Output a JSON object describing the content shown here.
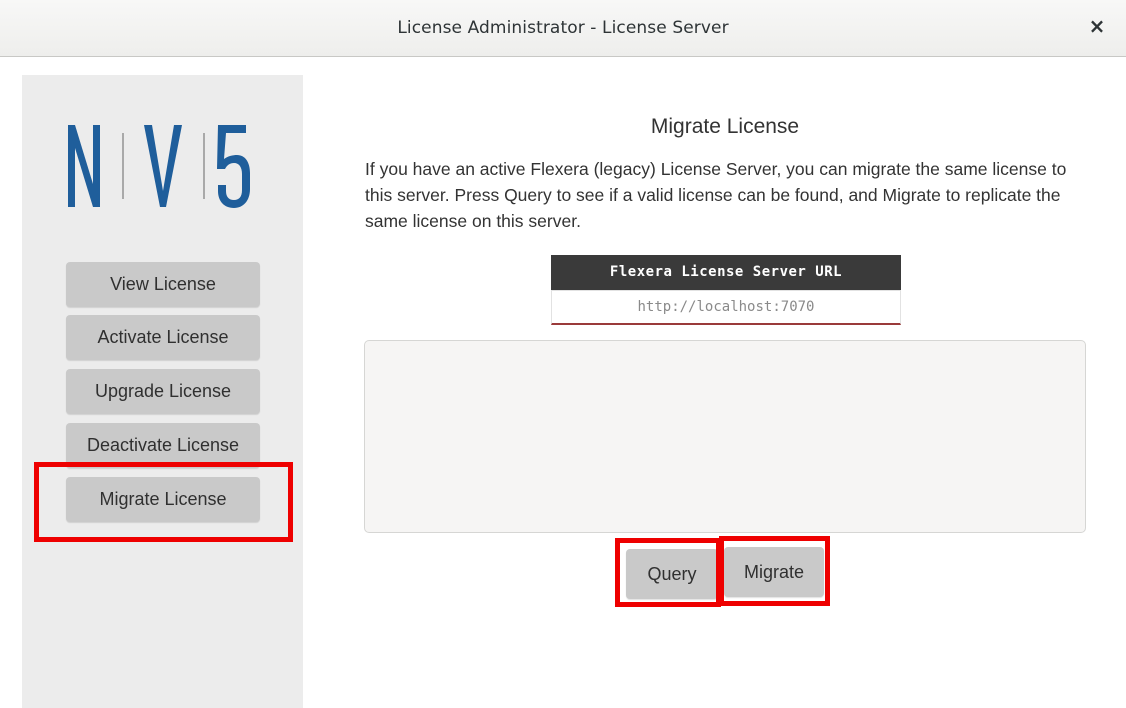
{
  "window": {
    "title": "License Administrator - License Server",
    "close_label": "×"
  },
  "logo": {
    "text": "NV5",
    "color": "#1f5e9b"
  },
  "sidebar": {
    "items": [
      {
        "label": "View License"
      },
      {
        "label": "Activate License"
      },
      {
        "label": "Upgrade License"
      },
      {
        "label": "Deactivate License"
      },
      {
        "label": "Migrate License",
        "highlighted": true
      }
    ]
  },
  "panel": {
    "title": "Migrate License",
    "description": "If you have an active Flexera (legacy) License Server, you can migrate the same license to this server. Press Query to see if a valid license can be found, and Migrate to replicate the same license on this server.",
    "url_label": "Flexera License Server URL",
    "url_placeholder": "http://localhost:7070",
    "output_text": ""
  },
  "actions": {
    "query_label": "Query",
    "migrate_label": "Migrate"
  },
  "colors": {
    "highlight": "#ee0000",
    "button_bg": "#c9c9c9",
    "sidebar_bg": "#ececec",
    "url_label_bg": "#3a3a3a"
  }
}
